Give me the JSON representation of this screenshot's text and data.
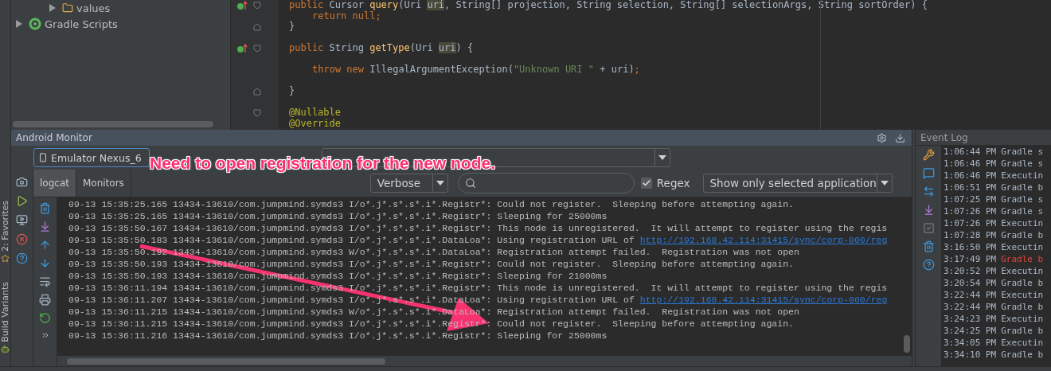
{
  "side_strip": {
    "tools": [
      {
        "label": "2: Favorites",
        "kind": "star"
      },
      {
        "label": "Build Variants",
        "kind": "android"
      }
    ]
  },
  "project_tree": {
    "items": [
      {
        "label": "values",
        "kind": "folder",
        "expanded": false
      },
      {
        "label": "Gradle Scripts",
        "kind": "gradle",
        "expanded": false
      }
    ]
  },
  "editor": {
    "lines": [
      {
        "kind": "code",
        "indent": false,
        "override": true,
        "fold_open": true,
        "fold_close": false,
        "tokens": [
          {
            "kind": "keyword",
            "text": "public"
          },
          {
            "kind": "plain",
            "text": " Cursor "
          },
          {
            "kind": "method",
            "text": "query"
          },
          {
            "kind": "plain",
            "text": "(Uri "
          },
          {
            "kind": "param",
            "text": "uri"
          },
          {
            "kind": "plain",
            "text": ", String[] projection, String selection, String[] selectionArgs, String sortOrder) {"
          }
        ]
      },
      {
        "kind": "code",
        "indent": true,
        "override": false,
        "fold_open": false,
        "fold_close": false,
        "tokens": [
          {
            "kind": "keyword",
            "text": "return null;"
          }
        ]
      },
      {
        "kind": "code",
        "indent": false,
        "override": false,
        "fold_open": false,
        "fold_close": true,
        "tokens": [
          {
            "kind": "plain",
            "text": "}"
          }
        ]
      },
      {
        "kind": "blank"
      },
      {
        "kind": "code",
        "indent": false,
        "override": true,
        "fold_open": true,
        "fold_close": false,
        "tokens": [
          {
            "kind": "keyword",
            "text": "public"
          },
          {
            "kind": "plain",
            "text": " String "
          },
          {
            "kind": "method",
            "text": "getType"
          },
          {
            "kind": "plain",
            "text": "(Uri "
          },
          {
            "kind": "param",
            "text": "uri"
          },
          {
            "kind": "plain",
            "text": ") {"
          }
        ]
      },
      {
        "kind": "blank"
      },
      {
        "kind": "code",
        "indent": true,
        "override": false,
        "fold_open": false,
        "fold_close": false,
        "tokens": [
          {
            "kind": "keyword",
            "text": "throw new"
          },
          {
            "kind": "plain",
            "text": " IllegalArgumentException("
          },
          {
            "kind": "string",
            "text": "\"Unknown URI \""
          },
          {
            "kind": "plain",
            "text": " + uri)"
          },
          {
            "kind": "keyword",
            "text": ";"
          }
        ]
      },
      {
        "kind": "blank"
      },
      {
        "kind": "code",
        "indent": false,
        "override": false,
        "fold_open": false,
        "fold_close": true,
        "tokens": [
          {
            "kind": "plain",
            "text": "}"
          }
        ]
      },
      {
        "kind": "blank"
      },
      {
        "kind": "code",
        "indent": false,
        "override": false,
        "fold_open": true,
        "fold_close": false,
        "tokens": [
          {
            "kind": "annotation",
            "text": "@Nullable"
          }
        ]
      },
      {
        "kind": "code",
        "indent": false,
        "override": false,
        "fold_open": false,
        "fold_close": false,
        "tokens": [
          {
            "kind": "annotation",
            "text": "@Override"
          }
        ]
      }
    ]
  },
  "android_monitor": {
    "title": "Android Monitor",
    "device": {
      "value": "Emulator Nexus_6"
    },
    "tabs": [
      {
        "label": "logcat",
        "selected": true
      },
      {
        "label": "Monitors",
        "selected": false
      }
    ],
    "log_level": {
      "value": "Verbose"
    },
    "regex": {
      "label": "Regex",
      "checked": true
    },
    "filter": {
      "value": "Show only selected application"
    },
    "log_lines": [
      {
        "text": "09-13 15:35:25.165 13434-13610/com.jumpmind.symds3 I/o*.j*.s*.s*.i*.Registr*: Could not register.  Sleeping before attempting again."
      },
      {
        "text": "09-13 15:35:25.165 13434-13610/com.jumpmind.symds3 I/o*.j*.s*.s*.i*.Registr*: Sleeping for 25000ms"
      },
      {
        "text": "09-13 15:35:50.167 13434-13610/com.jumpmind.symds3 I/o*.j*.s*.s*.i*.Registr*: This node is unregistered.  It will attempt to register using the regis"
      },
      {
        "text": "09-13 15:35:50.183 13434-13610/com.jumpmind.symds3 I/o*.j*.s*.s*.i*.DataLoa*: Using registration URL of",
        "link": "http://192.168.42.114:31415/sync/corp-000/reg"
      },
      {
        "text": "09-13 15:35:50.192 13434-13610/com.jumpmind.symds3 W/o*.j*.s*.s*.i*.DataLoa*: Registration attempt failed.  Registration was not open"
      },
      {
        "text": "09-13 15:35:50.193 13434-13610/com.jumpmind.symds3 I/o*.j*.s*.s*.i*.Registr*: Could not register.  Sleeping before attempting again."
      },
      {
        "text": "09-13 15:35:50.193 13434-13610/com.jumpmind.symds3 I/o*.j*.s*.s*.i*.Registr*: Sleeping for 21000ms"
      },
      {
        "text": "09-13 15:36:11.194 13434-13610/com.jumpmind.symds3 I/o*.j*.s*.s*.i*.Registr*: This node is unregistered.  It will attempt to register using the regis"
      },
      {
        "text": "09-13 15:36:11.207 13434-13610/com.jumpmind.symds3 I/o*.j*.s*.s*.i*.DataLoa*: Using registration URL of",
        "link": "http://192.168.42.114:31415/sync/corp-000/reg"
      },
      {
        "text": "09-13 15:36:11.215 13434-13610/com.jumpmind.symds3 W/o*.j*.s*.s*.i*.DataLoa*: Registration attempt failed.  Registration was not open"
      },
      {
        "text": "09-13 15:36:11.215 13434-13610/com.jumpmind.symds3 I/o*.j*.s*.s*.i*.Registr*: Could not register.  Sleeping before attempting again."
      },
      {
        "text": "09-13 15:36:11.216 13434-13610/com.jumpmind.symds3 I/o*.j*.s*.s*.i*.Registr*: Sleeping for 25000ms"
      }
    ]
  },
  "event_log": {
    "title": "Event Log",
    "entries": [
      {
        "time": "1:06:44 PM",
        "text": "Gradle s",
        "kind": "info"
      },
      {
        "time": "1:06:46 PM",
        "text": "Gradle s",
        "kind": "info"
      },
      {
        "time": "1:06:46 PM",
        "text": "Executin",
        "kind": "info"
      },
      {
        "time": "1:06:51 PM",
        "text": "Gradle b",
        "kind": "info"
      },
      {
        "time": "1:07:25 PM",
        "text": "Gradle s",
        "kind": "info"
      },
      {
        "time": "1:07:26 PM",
        "text": "Gradle s",
        "kind": "info"
      },
      {
        "time": "1:07:26 PM",
        "text": "Executin",
        "kind": "info"
      },
      {
        "time": "1:07:28 PM",
        "text": "Gradle b",
        "kind": "info"
      },
      {
        "time": "3:16:50 PM",
        "text": "Executin",
        "kind": "info"
      },
      {
        "time": "3:17:49 PM",
        "text": "Gradle b",
        "kind": "error"
      },
      {
        "time": "3:20:52 PM",
        "text": "Executin",
        "kind": "info"
      },
      {
        "time": "3:20:54 PM",
        "text": "Gradle b",
        "kind": "info"
      },
      {
        "time": "3:22:44 PM",
        "text": "Executin",
        "kind": "info"
      },
      {
        "time": "3:22:44 PM",
        "text": "Gradle b",
        "kind": "info"
      },
      {
        "time": "3:24:23 PM",
        "text": "Executin",
        "kind": "info"
      },
      {
        "time": "3:24:25 PM",
        "text": "Gradle b",
        "kind": "info"
      },
      {
        "time": "3:34:05 PM",
        "text": "Executin",
        "kind": "info"
      },
      {
        "time": "3:34:10 PM",
        "text": "Gradle b",
        "kind": "info"
      }
    ]
  },
  "annotation": {
    "text": "Need to open registration for the new node."
  }
}
